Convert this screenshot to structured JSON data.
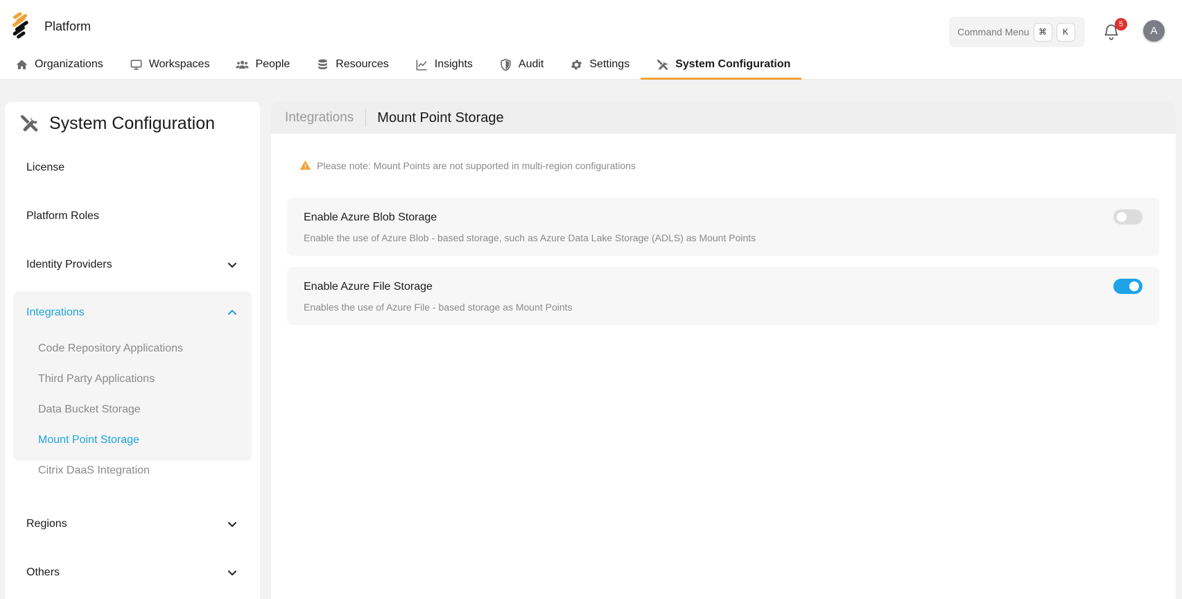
{
  "app": {
    "name": "Platform"
  },
  "command_menu": {
    "label": "Command Menu",
    "keys": [
      "⌘",
      "K"
    ]
  },
  "notifications": {
    "count": "5"
  },
  "user": {
    "avatar_initial": "A"
  },
  "nav": {
    "items": [
      {
        "label": "Organizations",
        "icon": "home-icon"
      },
      {
        "label": "Workspaces",
        "icon": "monitor-icon"
      },
      {
        "label": "People",
        "icon": "people-icon"
      },
      {
        "label": "Resources",
        "icon": "database-icon"
      },
      {
        "label": "Insights",
        "icon": "chart-line-icon"
      },
      {
        "label": "Audit",
        "icon": "shield-icon"
      },
      {
        "label": "Settings",
        "icon": "gear-icon"
      },
      {
        "label": "System Configuration",
        "icon": "tools-icon",
        "active": true
      }
    ]
  },
  "sidebar": {
    "title": "System Configuration",
    "items": [
      {
        "label": "License"
      },
      {
        "label": "Platform Roles"
      },
      {
        "label": "Identity Providers",
        "expandable": true,
        "expanded": false
      }
    ],
    "integrations": {
      "label": "Integrations",
      "expanded": true,
      "children": [
        {
          "label": "Code Repository Applications"
        },
        {
          "label": "Third Party Applications"
        },
        {
          "label": "Data Bucket Storage"
        },
        {
          "label": "Mount Point Storage",
          "active": true
        },
        {
          "label": "Citrix DaaS Integration"
        }
      ]
    },
    "after_items": [
      {
        "label": "Regions",
        "expandable": true,
        "expanded": false
      },
      {
        "label": "Others",
        "expandable": true,
        "expanded": false
      }
    ]
  },
  "breadcrumb": {
    "parent": "Integrations",
    "current": "Mount Point Storage"
  },
  "note": {
    "text": "Please note: Mount Points are not supported in multi-region configurations"
  },
  "settings": [
    {
      "title": "Enable Azure Blob Storage",
      "description": "Enable the use of Azure Blob - based storage, such as Azure Data Lake Storage (ADLS) as Mount Points",
      "enabled": false
    },
    {
      "title": "Enable Azure File Storage",
      "description": "Enables the use of Azure File - based storage as Mount Points",
      "enabled": true
    }
  ],
  "colors": {
    "accent": "#1fa3d9",
    "nav_active_underline": "#f0a23a",
    "toggle_on": "#1fa3e8",
    "toggle_off": "#dcdcdc",
    "warning": "#f0a23a",
    "badge": "#e03131"
  }
}
